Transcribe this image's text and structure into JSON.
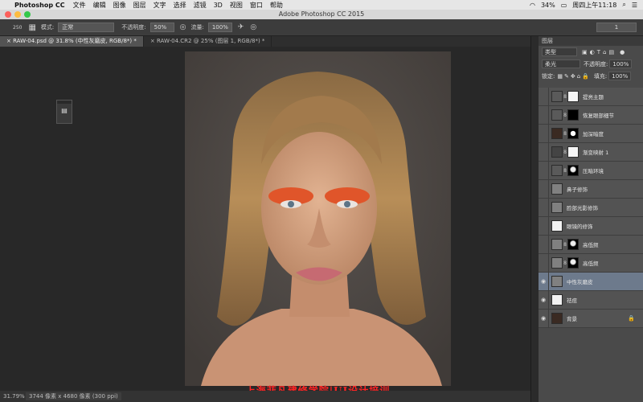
{
  "menubar": {
    "app": "Photoshop CC",
    "items": [
      "文件",
      "编辑",
      "图像",
      "图层",
      "文字",
      "选择",
      "滤镜",
      "3D",
      "视图",
      "窗口",
      "帮助"
    ],
    "battery": "34%",
    "clock": "周四上午11:18"
  },
  "window": {
    "title": "Adobe Photoshop CC 2015"
  },
  "options": {
    "brush_size": "250",
    "mode_label": "模式:",
    "mode_value": "正常",
    "opacity_label": "不透明度:",
    "opacity_value": "50%",
    "flow_label": "流量:",
    "flow_value": "100%",
    "right_value": "1"
  },
  "tabs": [
    {
      "label": "RAW-04.psd @ 31.8% (中性灰磨皮, RGB/8*) *",
      "active": true
    },
    {
      "label": "RAW-04.CR2 @ 25% (图层 1, RGB/8*) *",
      "active": false
    }
  ],
  "status": {
    "zoom": "31.79%",
    "dims": "3744 像素 x 4680 像素 (300 ppi)"
  },
  "watermark": "上海菲凡建修学院|UI设计培训",
  "layers_panel": {
    "title": "图层",
    "kind": "类型",
    "blend": "柔光",
    "opacity_label": "不透明度:",
    "opacity": "100%",
    "lock_label": "锁定:",
    "fill_label": "填充:",
    "fill": "100%",
    "layers": [
      {
        "name": "提亮主题",
        "visible": false,
        "type": "curve",
        "mask": "white"
      },
      {
        "name": "恢复眼部细节",
        "visible": false,
        "type": "levels",
        "mask": "black"
      },
      {
        "name": "加深暗度",
        "visible": false,
        "type": "photo",
        "mask": "dot"
      },
      {
        "name": "渐变映射 1",
        "visible": false,
        "type": "gradient",
        "mask": "white"
      },
      {
        "name": "压暗环境",
        "visible": false,
        "type": "curve",
        "mask": "portrait"
      },
      {
        "name": "鼻子修饰",
        "visible": false,
        "type": "gray",
        "mask": ""
      },
      {
        "name": "脸部光影修饰",
        "visible": false,
        "type": "gray",
        "mask": ""
      },
      {
        "name": "眼镜的修饰",
        "visible": false,
        "type": "blank",
        "mask": ""
      },
      {
        "name": "高低频",
        "visible": false,
        "type": "gray",
        "mask": "portrait"
      },
      {
        "name": "高低频",
        "visible": false,
        "type": "gray",
        "mask": "portrait"
      },
      {
        "name": "中性灰磨皮",
        "visible": true,
        "type": "gray",
        "mask": "",
        "selected": true
      },
      {
        "name": "祛痘",
        "visible": true,
        "type": "blank",
        "mask": ""
      },
      {
        "name": "背景",
        "visible": true,
        "type": "photo",
        "mask": "",
        "locked": true
      }
    ]
  },
  "colors": {
    "accent_selected": "#6d7a8c",
    "watermark": "#ff2323"
  }
}
